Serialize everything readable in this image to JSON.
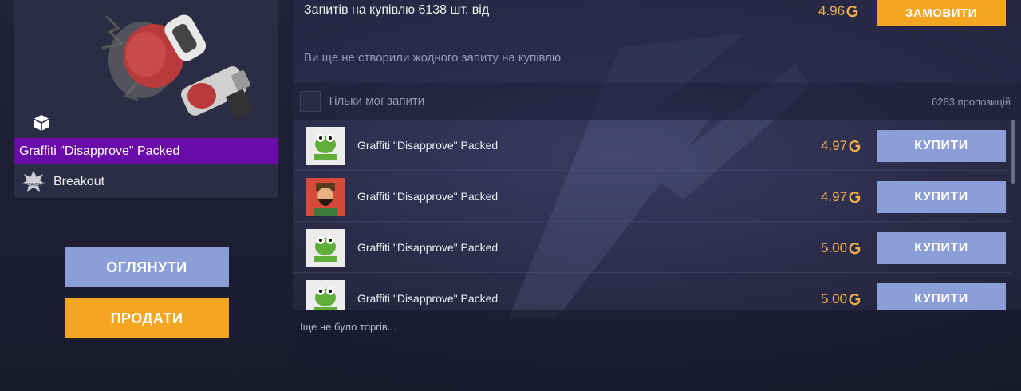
{
  "item": {
    "name": "Graffiti \"Disapprove\" Packed",
    "collection": "Breakout",
    "collection_badge": "BREAKOUT",
    "rarity_color": "#6a0aa8"
  },
  "actions": {
    "inspect_label": "ОГЛЯНУТИ",
    "sell_label": "ПРОДАТИ"
  },
  "buy_orders": {
    "summary": "Запитів на купівлю 6138 шт. від",
    "price": "4.96",
    "order_button": "ЗАМОВИТИ",
    "empty_message": "Ви ще не створили жодного запиту на купівлю"
  },
  "filter": {
    "label": "Тільки мої запити",
    "offers_count": "6283 пропозицій"
  },
  "listings": [
    {
      "name": "Graffiti \"Disapprove\" Packed",
      "price": "4.97",
      "button": "КУПИТИ",
      "thumb": "frog-icon"
    },
    {
      "name": "Graffiti \"Disapprove\" Packed",
      "price": "4.97",
      "button": "КУПИТИ",
      "thumb": "bearded-character-icon"
    },
    {
      "name": "Graffiti \"Disapprove\" Packed",
      "price": "5.00",
      "button": "КУПИТИ",
      "thumb": "frog-icon"
    },
    {
      "name": "Graffiti \"Disapprove\" Packed",
      "price": "5.00",
      "button": "КУПИТИ",
      "thumb": "frog-icon"
    }
  ],
  "trades": {
    "empty_message": "Іще не було торгів..."
  },
  "colors": {
    "accent_orange": "#f4a521",
    "accent_blue": "#8c9ed8",
    "price_gold": "#f4b04a"
  }
}
